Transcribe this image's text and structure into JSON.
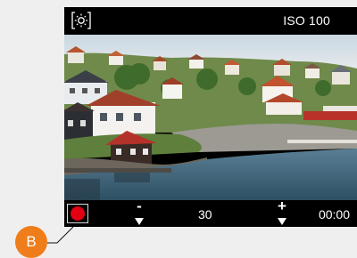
{
  "topbar": {
    "white_balance_icon": "sun-icon",
    "iso_label": "ISO 100"
  },
  "viewfinder": {
    "scene": "harbor-village-photo"
  },
  "bottombar": {
    "record_icon": "record-icon",
    "decrease_sign": "-",
    "value": "30",
    "increase_sign": "+",
    "timer": "00:00"
  },
  "callout": {
    "label": "B"
  },
  "colors": {
    "record": "#e00011",
    "callout": "#ef7d1a",
    "bar": "#000000"
  }
}
